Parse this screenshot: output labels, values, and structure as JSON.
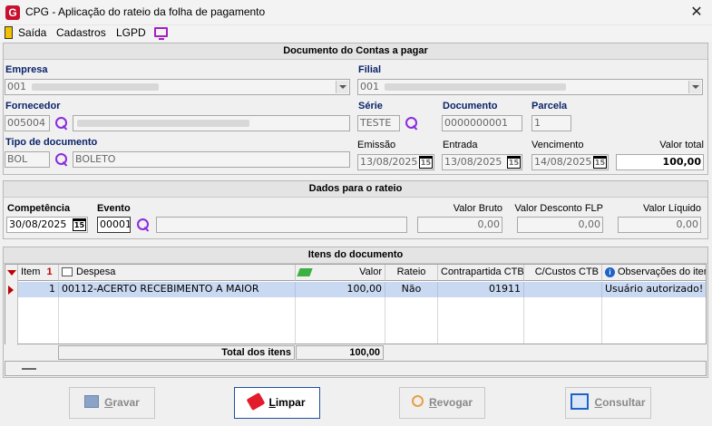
{
  "window": {
    "title": "CPG - Aplicação do rateio da folha de pagamento"
  },
  "menu": {
    "items": [
      "Saída",
      "Cadastros",
      "LGPD"
    ]
  },
  "doc_section": {
    "title": "Documento do Contas a pagar",
    "empresa_label": "Empresa",
    "empresa_value": "001",
    "filial_label": "Filial",
    "filial_value": "001",
    "fornecedor_label": "Fornecedor",
    "fornecedor_code": "005004",
    "serie_label": "Série",
    "serie_value": "TESTE",
    "documento_label": "Documento",
    "documento_value": "0000000001",
    "parcela_label": "Parcela",
    "parcela_value": "1",
    "tipo_label": "Tipo de documento",
    "tipo_code": "BOL",
    "tipo_desc": "BOLETO",
    "emissao_label": "Emissão",
    "emissao_value": "13/08/2025",
    "entrada_label": "Entrada",
    "entrada_value": "13/08/2025",
    "vencimento_label": "Vencimento",
    "vencimento_value": "14/08/2025",
    "valor_total_label": "Valor total",
    "valor_total_value": "100,00"
  },
  "rateio_section": {
    "title": "Dados para o rateio",
    "competencia_label": "Competência",
    "competencia_value": "30/08/2025",
    "evento_label": "Evento",
    "evento_value": "00001",
    "valor_bruto_label": "Valor Bruto",
    "valor_bruto_value": "0,00",
    "valor_desconto_label": "Valor Desconto FLP",
    "valor_desconto_value": "0,00",
    "valor_liquido_label": "Valor Líquido",
    "valor_liquido_value": "0,00"
  },
  "items_section": {
    "title": "Itens do documento",
    "columns": [
      "Item",
      "Despesa",
      "Valor",
      "Rateio",
      "Contrapartida CTB",
      "C/Custos CTB",
      "Observações do item"
    ],
    "sort_indicator": "1",
    "rows": [
      {
        "item": "1",
        "despesa": "00112-ACERTO RECEBIMENTO A MAIOR",
        "valor": "100,00",
        "rateio": "Não",
        "contrapartida": "01911",
        "ccustos": "",
        "obs": "Usuário autorizado!"
      }
    ],
    "total_label": "Total dos itens",
    "total_value": "100,00"
  },
  "buttons": {
    "gravar_first": "G",
    "gravar_rest": "ravar",
    "limpar_first": "L",
    "limpar_rest": "impar",
    "revogar_first": "R",
    "revogar_rest": "evogar",
    "consultar_first": "C",
    "consultar_rest": "onsultar"
  },
  "colors": {
    "label_blue": "#0a246a",
    "selection": "#c9d9f2",
    "accent_purple": "#8a2be2",
    "logo_red": "#c8102e"
  }
}
